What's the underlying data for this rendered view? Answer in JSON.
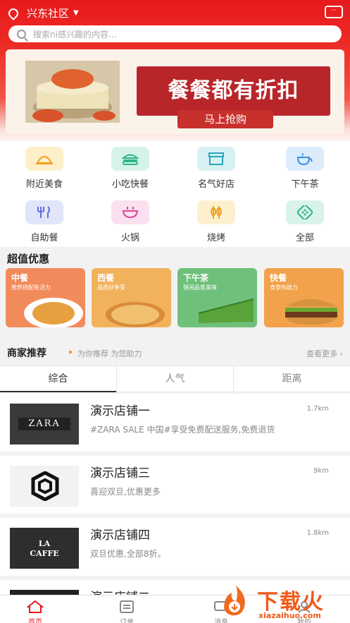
{
  "header": {
    "location": "兴东社区",
    "search_placeholder": "搜索ni感兴趣的内容..."
  },
  "banner": {
    "headline": "餐餐都有折扣",
    "cta": "马上抢购"
  },
  "categories": [
    {
      "label": "附近美食",
      "icon": "cloche-icon",
      "bg": "#fdf0c8"
    },
    {
      "label": "小吃快餐",
      "icon": "burger-icon",
      "bg": "#d6f3ea"
    },
    {
      "label": "名气好店",
      "icon": "storefront-icon",
      "bg": "#d7f1f3"
    },
    {
      "label": "下午茶",
      "icon": "teacup-icon",
      "bg": "#dcecfb"
    },
    {
      "label": "自助餐",
      "icon": "fork-knife-icon",
      "bg": "#e1e6fb"
    },
    {
      "label": "火锅",
      "icon": "hotpot-icon",
      "bg": "#fbe0ef"
    },
    {
      "label": "烧烤",
      "icon": "skewer-icon",
      "bg": "#fdf0cf"
    },
    {
      "label": "全部",
      "icon": "grid-dots-icon",
      "bg": "#d9f3e8"
    }
  ],
  "deals": {
    "title": "超值优惠",
    "items": [
      {
        "title": "中餐",
        "subtitle": "营养搭配有活力",
        "color": "#f28b5c"
      },
      {
        "title": "西餐",
        "subtitle": "品质好享受",
        "color": "#f2b25c"
      },
      {
        "title": "下午茶",
        "subtitle": "惬闲品茗美味",
        "color": "#6fc07a"
      },
      {
        "title": "快餐",
        "subtitle": "食堂你助力",
        "color": "#f2a24a"
      }
    ]
  },
  "shops": {
    "title": "商家推荐",
    "subtitle": "为你推荐 为您助力",
    "more": "查看更多",
    "tabs": [
      "综合",
      "人气",
      "距离"
    ],
    "items": [
      {
        "name": "演示店铺一",
        "distance": "1.7km",
        "desc": "#ZARA SALE 中国#享受免费配送服务,免费退货",
        "logo": "ZARA"
      },
      {
        "name": "演示店铺三",
        "distance": "9km",
        "desc": "喜迎双旦,优惠更多",
        "logo": ""
      },
      {
        "name": "演示店铺四",
        "distance": "1.8km",
        "desc": "双旦优惠,全部8折。",
        "logo": "LA CAFFE"
      },
      {
        "name": "演示店铺二",
        "distance": "",
        "desc": "",
        "logo": ""
      }
    ]
  },
  "tabbar": {
    "items": [
      {
        "label": "首页",
        "icon": "home-icon"
      },
      {
        "label": "订单",
        "icon": "order-list-icon"
      },
      {
        "label": "消息",
        "icon": "message-icon"
      },
      {
        "label": "我的",
        "icon": "profile-icon"
      }
    ]
  },
  "watermark": {
    "brand": "下载火",
    "url": "xiazaihuo.com"
  }
}
